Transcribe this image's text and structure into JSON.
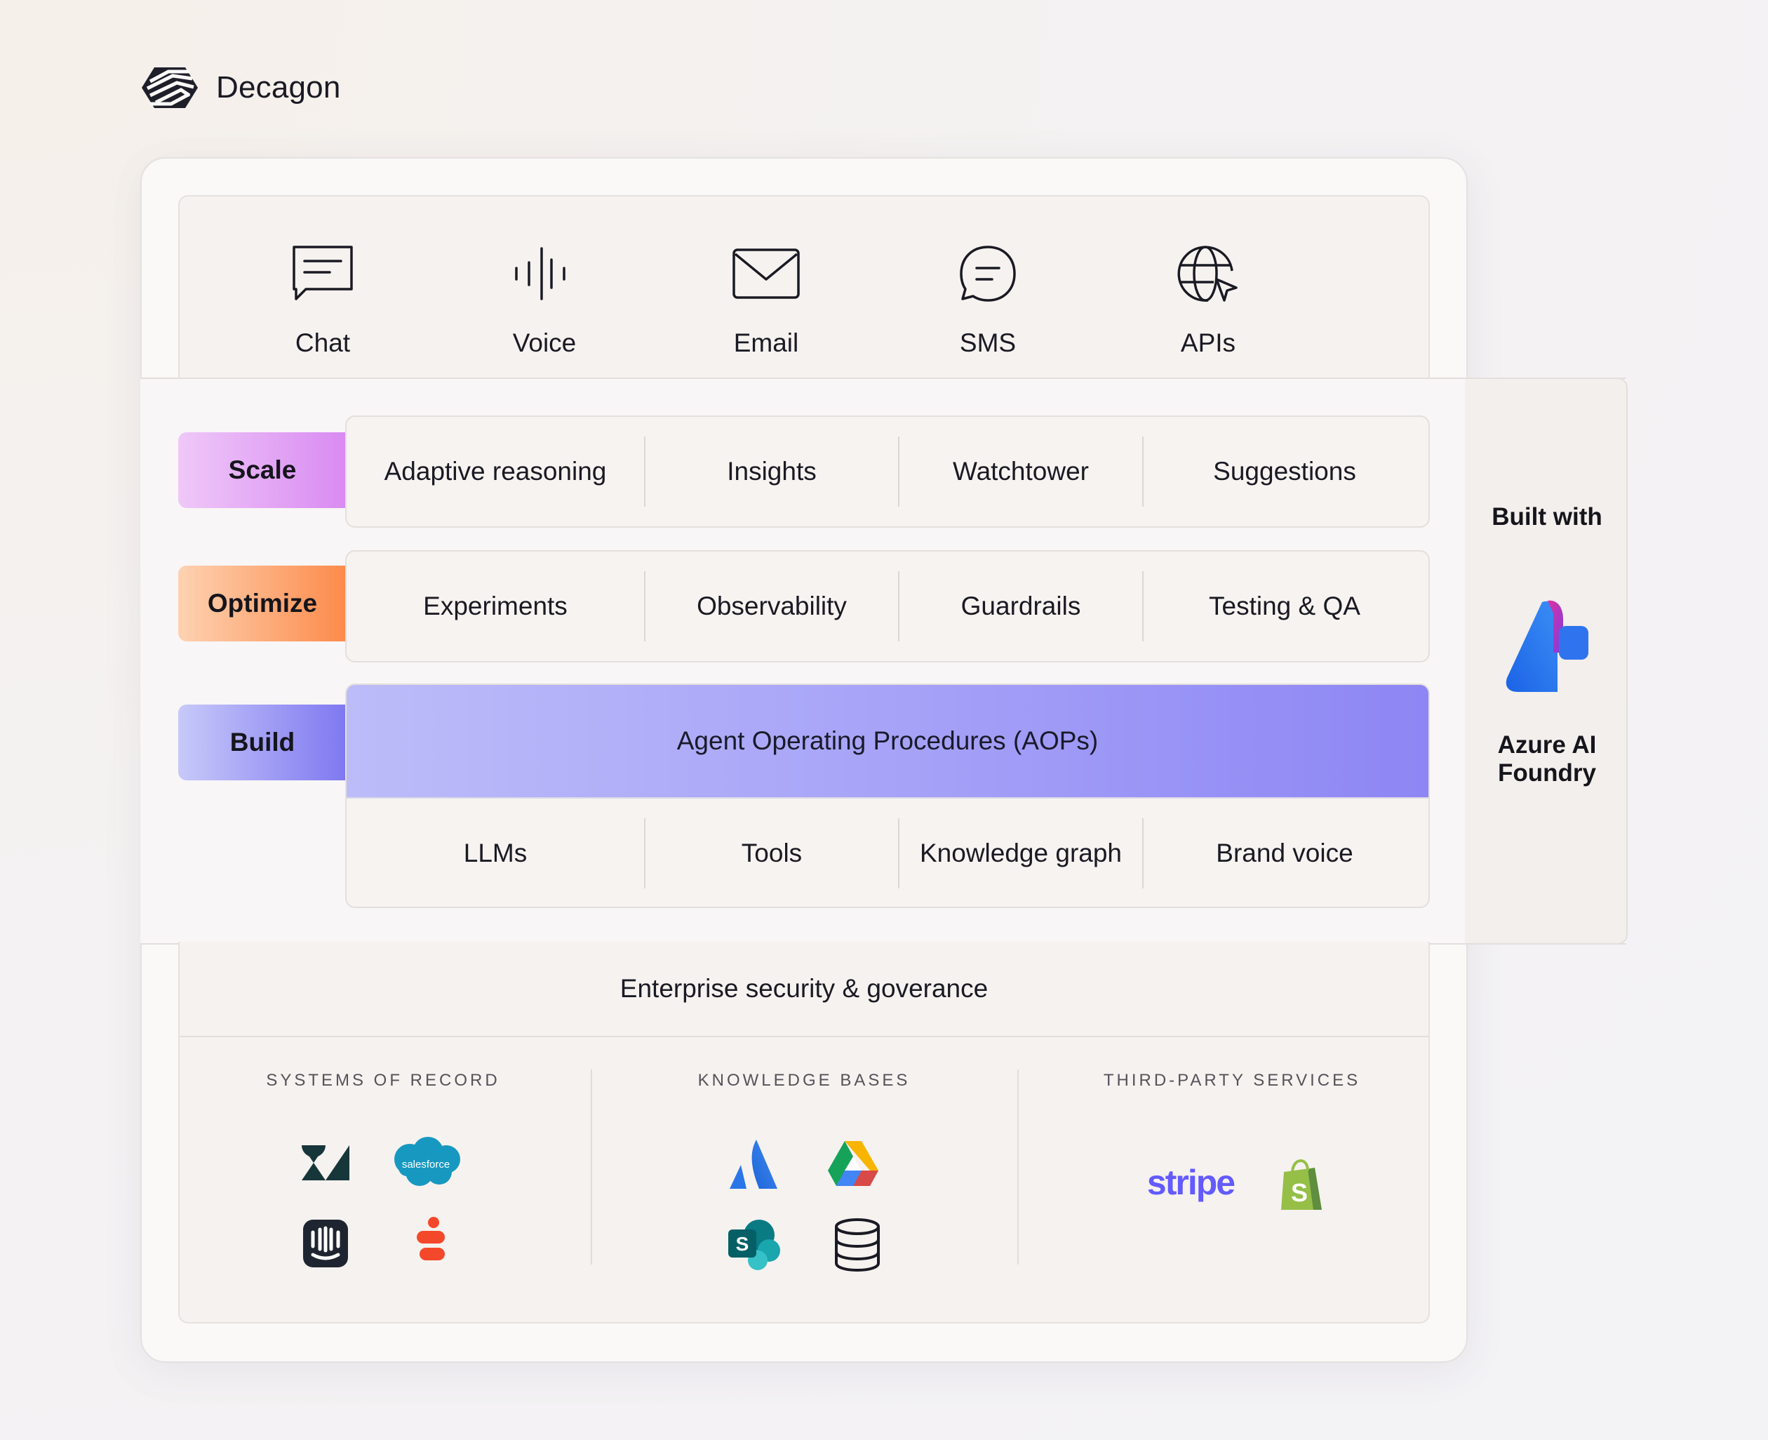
{
  "brand": {
    "name": "Decagon",
    "logo_icon": "decagon-logo-icon"
  },
  "channels": [
    {
      "label": "Chat",
      "icon": "chat-icon"
    },
    {
      "label": "Voice",
      "icon": "voice-waveform-icon"
    },
    {
      "label": "Email",
      "icon": "envelope-icon"
    },
    {
      "label": "SMS",
      "icon": "message-bubble-icon"
    },
    {
      "label": "APIs",
      "icon": "globe-cursor-icon"
    }
  ],
  "layers": {
    "scale": {
      "label": "Scale",
      "items": [
        "Adaptive reasoning",
        "Insights",
        "Watchtower",
        "Suggestions"
      ],
      "color": "#d98af2"
    },
    "optimize": {
      "label": "Optimize",
      "items": [
        "Experiments",
        "Observability",
        "Guardrails",
        "Testing & QA"
      ],
      "color": "#fd8a4a"
    },
    "build": {
      "label": "Build",
      "header": "Agent Operating Procedures (AOPs)",
      "items": [
        "LLMs",
        "Tools",
        "Knowledge graph",
        "Brand voice"
      ],
      "color": "#7f78f1"
    }
  },
  "built_with": {
    "label": "Built with",
    "product": "Azure AI Foundry",
    "icon": "azure-ai-foundry-icon"
  },
  "security": {
    "label": "Enterprise security & goverance"
  },
  "integrations": {
    "systems_of_record": {
      "title": "SYSTEMS OF RECORD",
      "logos": [
        "zendesk-icon",
        "salesforce-icon",
        "intercom-icon",
        "gladly-icon"
      ],
      "salesforce_text": "salesforce"
    },
    "knowledge_bases": {
      "title": "KNOWLEDGE BASES",
      "logos": [
        "atlassian-icon",
        "google-drive-icon",
        "sharepoint-icon",
        "database-icon"
      ],
      "sharepoint_text": "S"
    },
    "third_party_services": {
      "title": "THIRD-PARTY SERVICES",
      "logos": [
        "stripe-icon",
        "shopify-icon"
      ],
      "stripe_text": "stripe",
      "shopify_text": "S"
    }
  }
}
